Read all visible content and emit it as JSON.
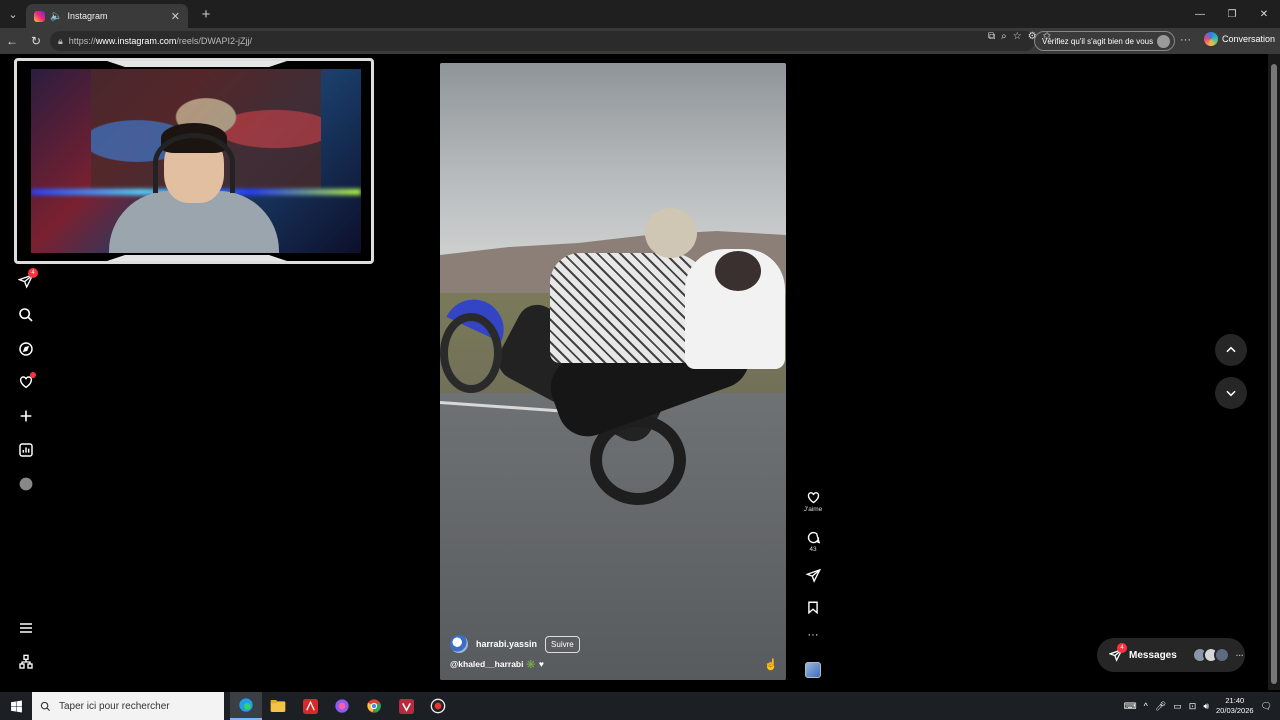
{
  "browser": {
    "tab_title": "Instagram",
    "url_prefix": "https://",
    "url_host": "www.instagram.com",
    "url_path": "/reels/DWAPI2-jZjj/",
    "verify_label": "Vérifiez qu'il s'agit bien de vous",
    "conversation_label": "Conversation"
  },
  "sidebar": {
    "notifications_badge": "4"
  },
  "reel": {
    "author": "harrabi.yassin",
    "follow_label": "Suivre",
    "caption": "@khaled__harrabi",
    "caption_suffix": "✳️ ♥"
  },
  "actions": {
    "like_label": "J'aime",
    "comments_count": "43"
  },
  "messages": {
    "label": "Messages",
    "badge": "4"
  },
  "taskbar": {
    "search_placeholder": "Taper ici pour rechercher",
    "time": "21:40",
    "date": "20/03/2026"
  },
  "colors": {
    "accent_badge": "#ff3040",
    "page_bg": "#000000"
  }
}
